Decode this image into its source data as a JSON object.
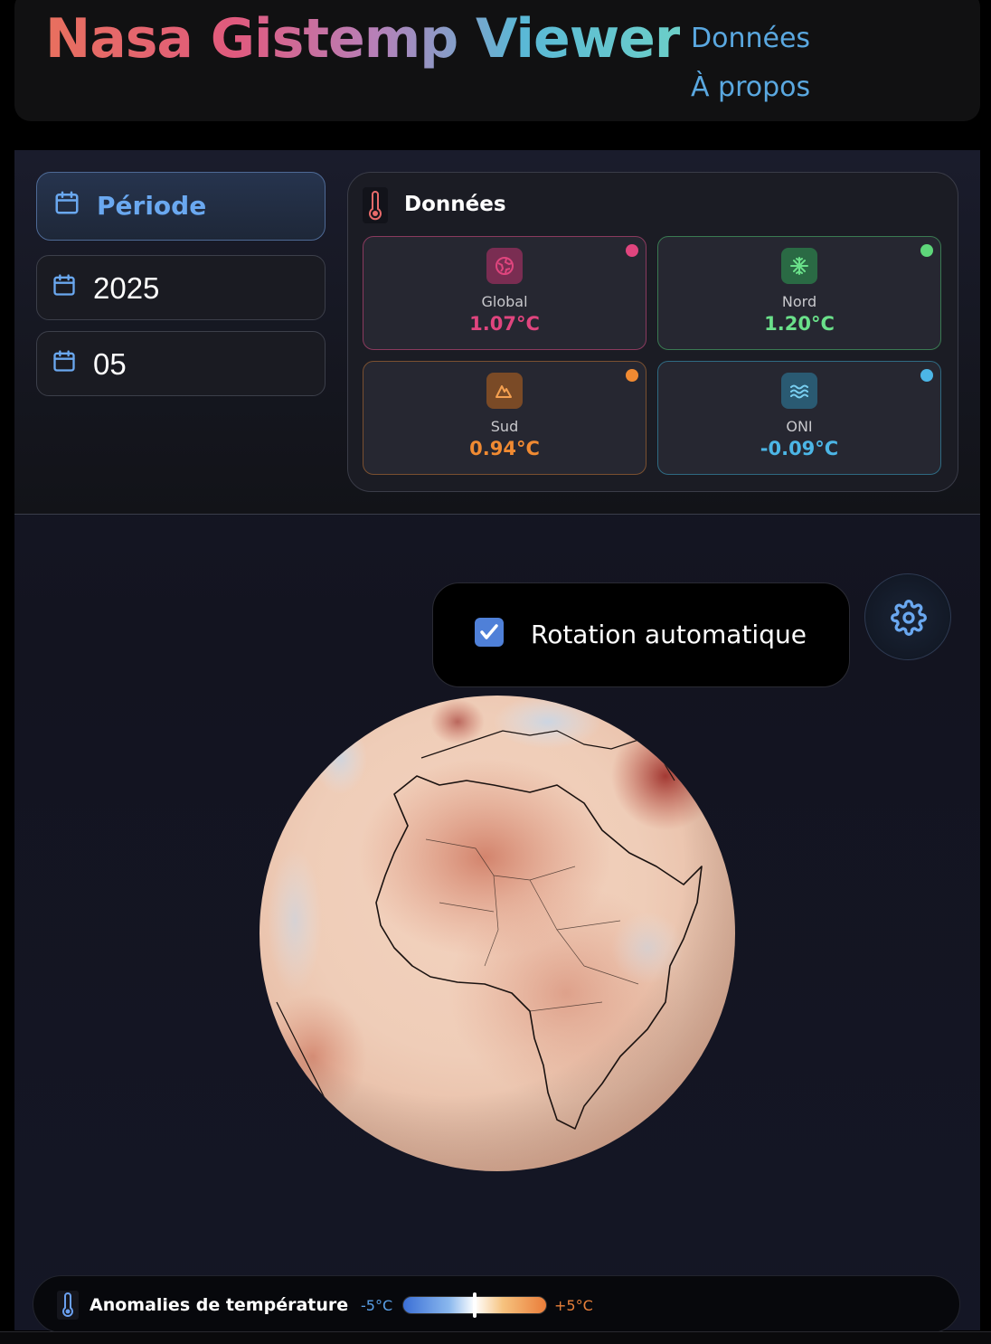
{
  "app": {
    "title": "Nasa Gistemp Viewer"
  },
  "nav": {
    "items": [
      {
        "label": "Données"
      },
      {
        "label": "À propos"
      }
    ]
  },
  "period": {
    "label": "Période",
    "year": "2025",
    "month": "05"
  },
  "data_panel": {
    "title": "Données",
    "cards": [
      {
        "name": "Global",
        "value": "1.07°C",
        "color": "#e0457e",
        "icon": "globe-icon"
      },
      {
        "name": "Nord",
        "value": "1.20°C",
        "color": "#5ed67a",
        "icon": "snowflake-icon"
      },
      {
        "name": "Sud",
        "value": "0.94°C",
        "color": "#f08a32",
        "icon": "mountain-icon"
      },
      {
        "name": "ONI",
        "value": "-0.09°C",
        "color": "#4cb6e6",
        "icon": "waves-icon"
      }
    ]
  },
  "controls": {
    "auto_rotate_label": "Rotation automatique",
    "auto_rotate_checked": true
  },
  "legend": {
    "title": "Anomalies de température",
    "min": "-5°C",
    "max": "+5°C"
  },
  "colors": {
    "accent_blue": "#5aa8e0",
    "checkbox": "#4f80d8"
  }
}
